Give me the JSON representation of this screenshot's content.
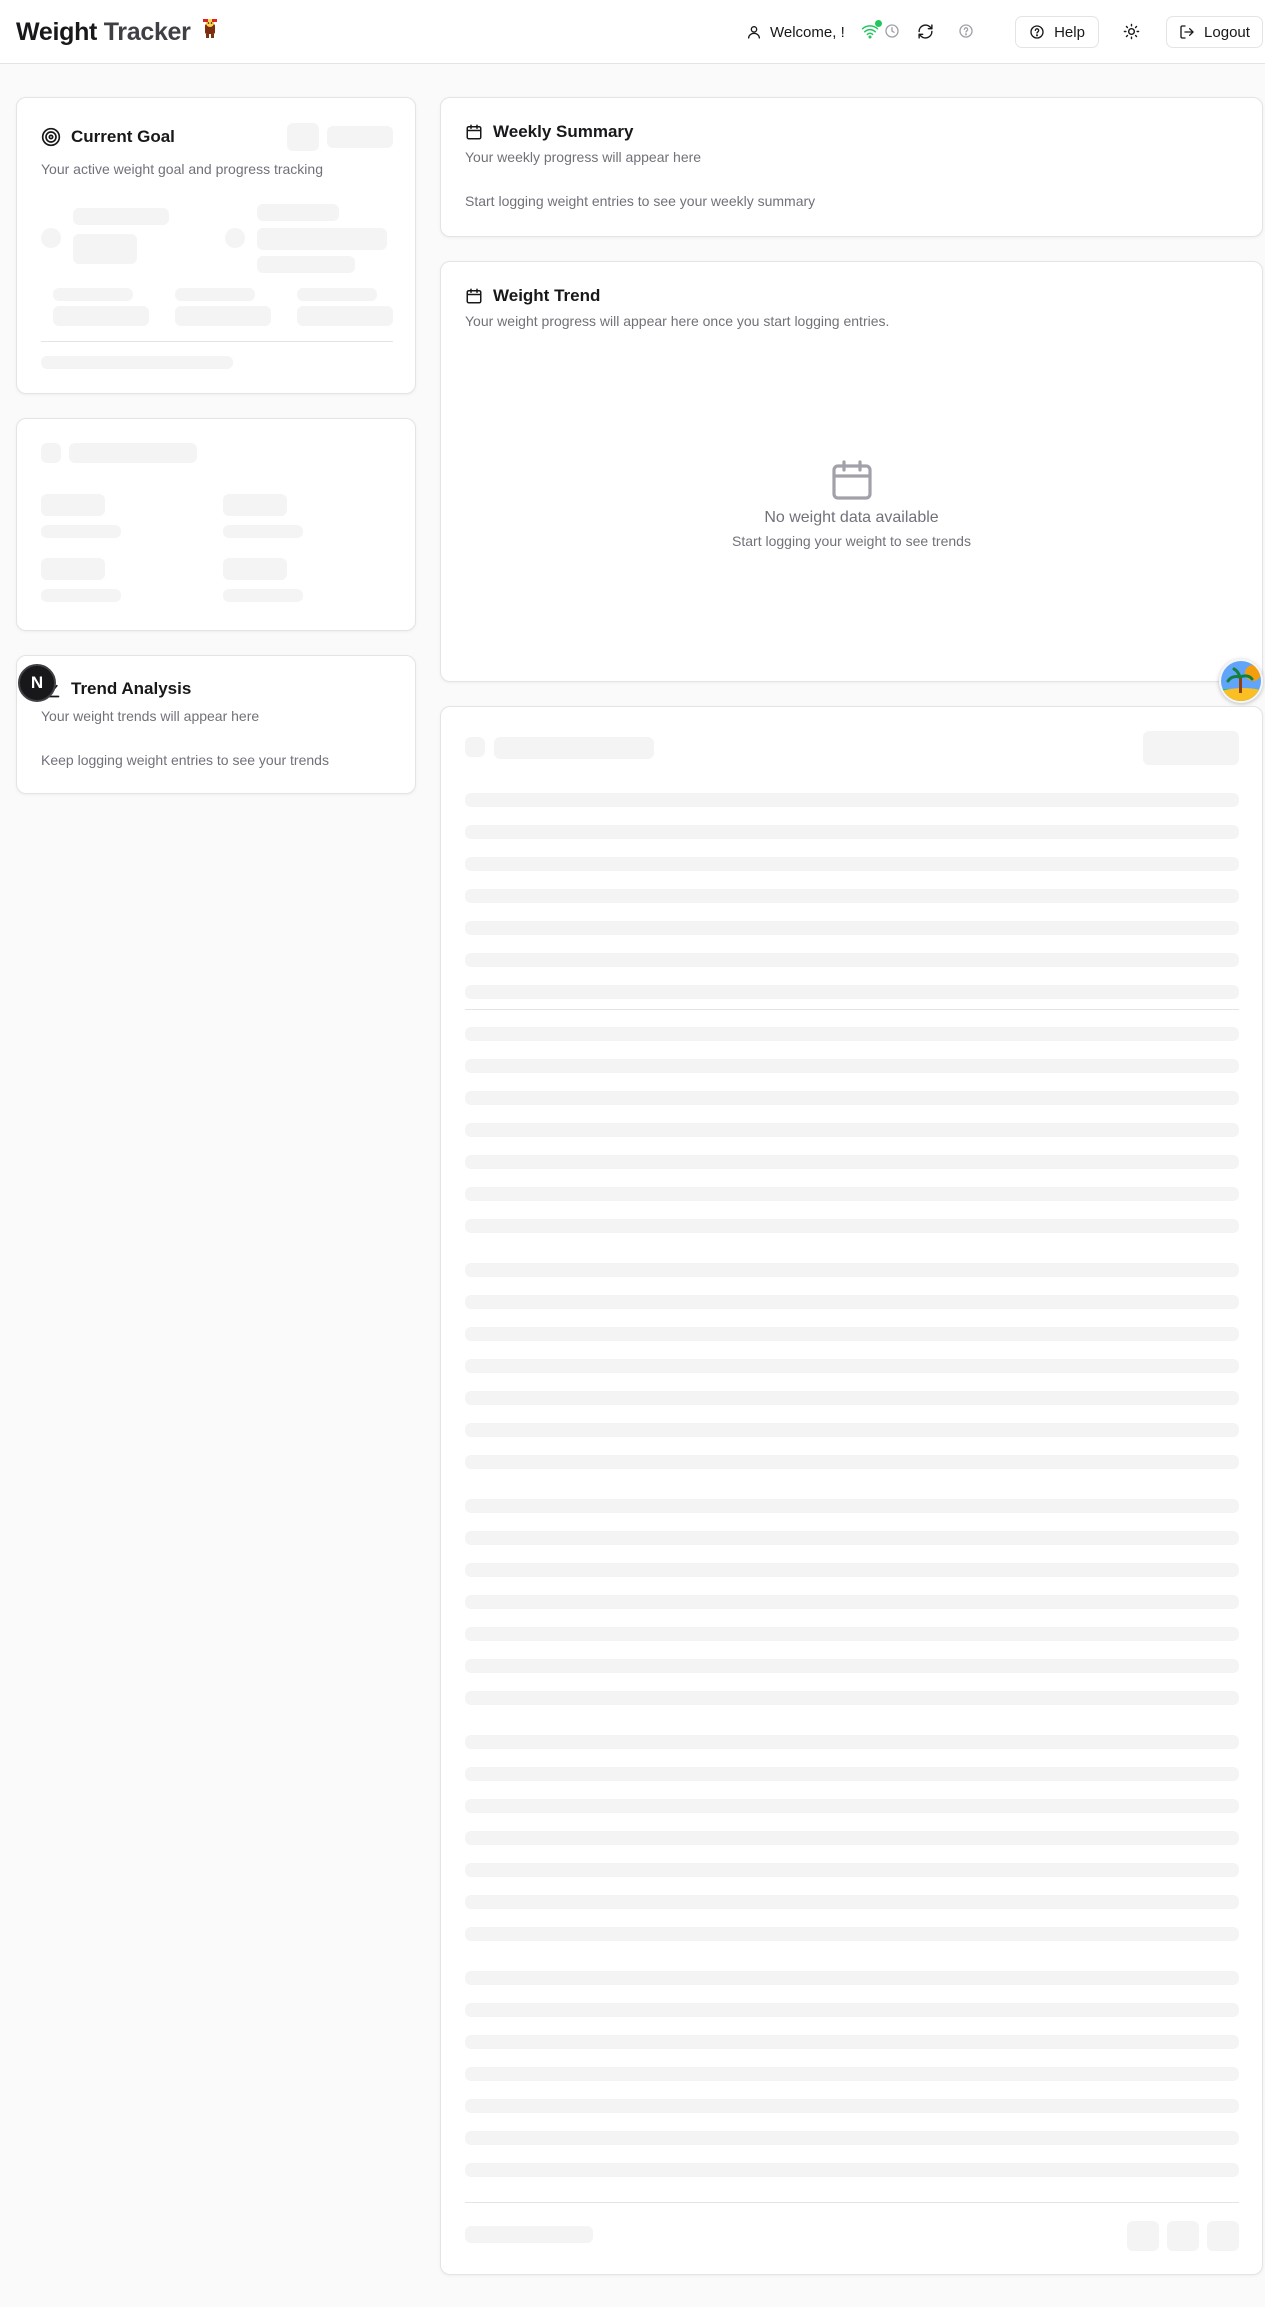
{
  "header": {
    "title_part1": "Weight",
    "title_part2": "Tracker",
    "welcome": "Welcome, !",
    "help_label": "Help",
    "logout_label": "Logout",
    "icons": [
      "user-icon",
      "wifi-icon",
      "clock-icon",
      "refresh-icon",
      "help-circle-icon",
      "sun-icon",
      "logout-icon"
    ]
  },
  "current_goal": {
    "title": "Current Goal",
    "description": "Your active weight goal and progress tracking"
  },
  "trend_analysis": {
    "title": "Trend Analysis",
    "description": "Your weight trends will appear here",
    "body": "Keep logging weight entries to see your trends"
  },
  "weekly_summary": {
    "title": "Weekly Summary",
    "description": "Your weekly progress will appear here",
    "body": "Start logging weight entries to see your weekly summary"
  },
  "weight_trend": {
    "title": "Weight Trend",
    "description": "Your weight progress will appear here once you start logging entries.",
    "empty_title": "No weight data available",
    "empty_subtitle": "Start logging your weight to see trends"
  },
  "badge": {
    "letter": "N"
  },
  "colors": {
    "accent_green": "#22c55e",
    "border": "#e4e4e7",
    "skeleton": "#f4f4f5",
    "muted_text": "#71717a"
  }
}
